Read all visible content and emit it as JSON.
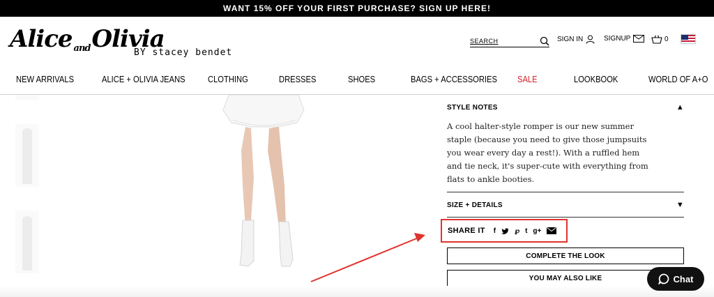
{
  "promo": {
    "text": "WANT 15% OFF YOUR FIRST PURCHASE? SIGN UP HERE!"
  },
  "logo": {
    "script": "Alice",
    "and": "and",
    "script2": "Olivia",
    "by": "BY stacey bendet"
  },
  "header": {
    "search_label": "SEARCH",
    "signin_label": "SIGN IN",
    "signup_label": "SIGNUP",
    "cart_count": "0"
  },
  "nav": {
    "items": [
      "NEW ARRIVALS",
      "ALICE + OLIVIA JEANS",
      "CLOTHING",
      "DRESSES",
      "SHOES",
      "BAGS + ACCESSORIES",
      "SALE",
      "LOOKBOOK",
      "WORLD OF A+O"
    ]
  },
  "details": {
    "style_notes_title": "STYLE NOTES",
    "style_notes_text": "A cool halter-style romper is our new summer staple (because you need to give those jumpsuits you wear every day a rest!). With a ruffled hem and tie neck, it's super-cute with everything from flats to ankle booties.",
    "size_title": "SIZE + DETAILS",
    "share_label": "SHARE IT",
    "complete_look": "COMPLETE THE LOOK",
    "may_also_like": "YOU MAY ALSO LIKE"
  },
  "chat": {
    "label": "Chat"
  },
  "colors": {
    "sale": "#d2232a",
    "annotation": "#e0322d",
    "promo_bg": "#000000"
  }
}
